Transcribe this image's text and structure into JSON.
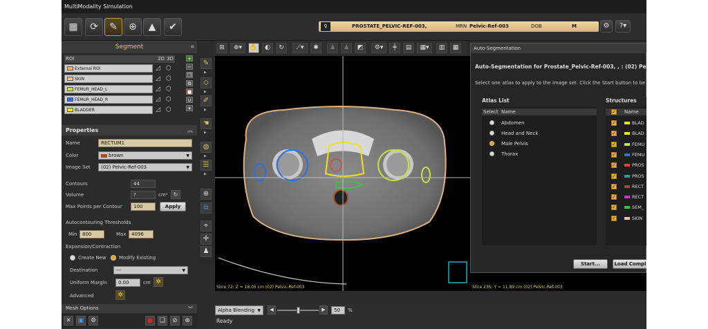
{
  "window": {
    "title": "MultiModality Simulation"
  },
  "patient": {
    "name": "PROSTATE_PELVIC-REF-003,",
    "mrn_label": "MRN",
    "mrn": "Pelvic-Ref-003",
    "dob_label": "DOB",
    "sex": "M"
  },
  "segment_panel": {
    "title": "Segment",
    "roi_header": "ROI",
    "col_2d": "2D",
    "col_3d": "3D",
    "rois": [
      {
        "name": "External ROI",
        "color": "#f0b070"
      },
      {
        "name": "SKIN",
        "color": "#f0c890"
      },
      {
        "name": "FEMUR_HEAD_L",
        "color": "#c8e040"
      },
      {
        "name": "FEMUR_HEAD_R",
        "color": "#3070e0"
      },
      {
        "name": "BLADDER",
        "color": "#f0e020"
      }
    ]
  },
  "properties": {
    "title": "Properties",
    "name_label": "Name",
    "name_value": "RECTUM1",
    "color_label": "Color",
    "color_value": "brown",
    "color_swatch": "#a0502a",
    "imageset_label": "Image Set",
    "imageset_value": "(02) Pelvic-Ref-003",
    "contours_label": "Contours",
    "contours_value": "44",
    "volume_label": "Volume",
    "volume_value": "?",
    "volume_unit": "cm³",
    "maxpoints_label": "Max Points per Contour",
    "maxpoints_value": "100",
    "apply_label": "Apply",
    "autocontour_label": "Autocontouring Thresholds",
    "min_label": "Min",
    "min_value": "800",
    "max_label": "Max",
    "max_value": "4096",
    "expansion_label": "Expansion/Contraction",
    "create_new_label": "Create New",
    "modify_existing_label": "Modify Existing",
    "destination_label": "Destination",
    "destination_value": "---",
    "uniform_margin_label": "Uniform Margin",
    "uniform_margin_value": "0.00",
    "uniform_margin_unit": "cm",
    "advanced_label": "Advanced",
    "mesh_options_label": "Mesh Options"
  },
  "viewer": {
    "left_status": "Slice 72: Z = 18.05 cm (02) Pelvic-Ref-003",
    "right_status": "Slice 235: Y = 11.89 cm (02) Pelvic-Ref-003"
  },
  "auto_segmentation": {
    "window_title": "Auto-Segmentation",
    "heading": "Auto-Segmentation for Prostate_Pelvic-Ref-003, ,  : (02) Pelvi",
    "instruction": "Select one atlas to apply to the image set. Click the Start button to be",
    "atlas_list_title": "Atlas List",
    "col_select": "Select",
    "col_name": "Name",
    "atlases": [
      "Abdomen",
      "Head and Neck",
      "Male Pelvis",
      "Thorax"
    ],
    "selected_atlas": "Male Pelvis",
    "structures_title": "Structures",
    "structures_col_name": "Name",
    "structures": [
      {
        "name": "BLAD",
        "color": "#f0e020"
      },
      {
        "name": "BLAD",
        "color": "#f0e020"
      },
      {
        "name": "FEMU",
        "color": "#c8e040"
      },
      {
        "name": "FEMU",
        "color": "#3070e0"
      },
      {
        "name": "PROS",
        "color": "#e04040"
      },
      {
        "name": "PROS",
        "color": "#20a0a0"
      },
      {
        "name": "RECT",
        "color": "#a0502a"
      },
      {
        "name": "RECT",
        "color": "#d030d0"
      },
      {
        "name": "SEM_",
        "color": "#40c040"
      },
      {
        "name": "SKIN",
        "color": "#f0c890"
      }
    ],
    "start_label": "Start...",
    "load_label": "Load Compl"
  },
  "bottom": {
    "blend_mode": "Alpha Blending",
    "blend_value": "50",
    "blend_unit": "%",
    "blend_level": 0.5,
    "status": "Ready"
  }
}
